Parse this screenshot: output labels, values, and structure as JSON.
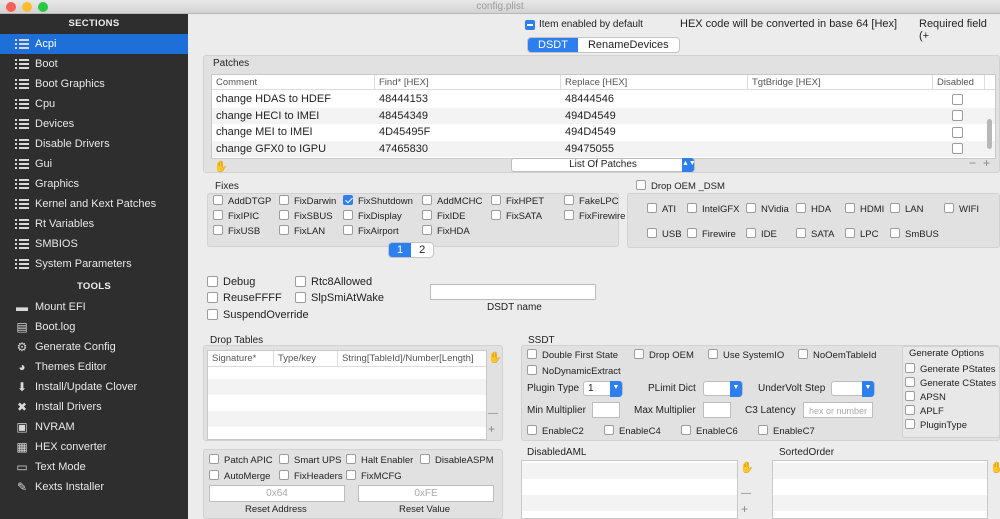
{
  "window": {
    "title": "config.plist"
  },
  "sidebar": {
    "sections_header": "SECTIONS",
    "tools_header": "TOOLS",
    "sections": [
      {
        "label": "Acpi",
        "active": true
      },
      {
        "label": "Boot"
      },
      {
        "label": "Boot Graphics"
      },
      {
        "label": "Cpu"
      },
      {
        "label": "Devices"
      },
      {
        "label": "Disable Drivers"
      },
      {
        "label": "Gui"
      },
      {
        "label": "Graphics"
      },
      {
        "label": "Kernel and Kext Patches"
      },
      {
        "label": "Rt Variables"
      },
      {
        "label": "SMBIOS"
      },
      {
        "label": "System Parameters"
      }
    ],
    "tools": [
      {
        "label": "Mount EFI",
        "icon": "drive-icon"
      },
      {
        "label": "Boot.log",
        "icon": "document-icon"
      },
      {
        "label": "Generate Config",
        "icon": "gear-icon"
      },
      {
        "label": "Themes Editor",
        "icon": "palette-icon"
      },
      {
        "label": "Install/Update Clover",
        "icon": "download-icon"
      },
      {
        "label": "Install Drivers",
        "icon": "wrench-icon"
      },
      {
        "label": "NVRAM",
        "icon": "chip-icon"
      },
      {
        "label": "HEX converter",
        "icon": "calculator-icon"
      },
      {
        "label": "Text Mode",
        "icon": "text-icon"
      },
      {
        "label": "Kexts Installer",
        "icon": "kext-icon"
      }
    ]
  },
  "topbar": {
    "item_enabled": "Item enabled by default",
    "hex_note": "HEX code will be converted in base 64 [Hex]",
    "required": "Required field (+"
  },
  "tabs": {
    "dsdt": "DSDT",
    "rename": "RenameDevices"
  },
  "patches": {
    "title": "Patches",
    "headers": [
      "Comment",
      "Find* [HEX]",
      "Replace [HEX]",
      "TgtBridge [HEX]",
      "Disabled"
    ],
    "rows": [
      {
        "comment": "change HDAS to HDEF",
        "find": "48444153",
        "replace": "48444546"
      },
      {
        "comment": "change HECI to IMEI",
        "find": "48454349",
        "replace": "494D4549"
      },
      {
        "comment": "change MEI to IMEI",
        "find": "4D45495F",
        "replace": "494D4549"
      },
      {
        "comment": "change GFX0 to IGPU",
        "find": "47465830",
        "replace": "49475055"
      }
    ],
    "list_popup": "List Of Patches",
    "minus": "−",
    "plus": "+"
  },
  "fixes": {
    "title": "Fixes",
    "items": [
      {
        "label": "AddDTGP",
        "checked": false
      },
      {
        "label": "FixDarwin",
        "checked": false
      },
      {
        "label": "FixShutdown",
        "checked": true
      },
      {
        "label": "AddMCHC",
        "checked": false
      },
      {
        "label": "FixHPET",
        "checked": false
      },
      {
        "label": "FakeLPC",
        "checked": false
      },
      {
        "label": "FixIPIC",
        "checked": false
      },
      {
        "label": "FixSBUS",
        "checked": false
      },
      {
        "label": "FixDisplay",
        "checked": false
      },
      {
        "label": "FixIDE",
        "checked": false
      },
      {
        "label": "FixSATA",
        "checked": false
      },
      {
        "label": "FixFirewire",
        "checked": false
      },
      {
        "label": "FixUSB",
        "checked": false
      },
      {
        "label": "FixLAN",
        "checked": false
      },
      {
        "label": "FixAirport",
        "checked": false
      },
      {
        "label": "FixHDA",
        "checked": false
      }
    ],
    "pages": [
      "1",
      "2"
    ]
  },
  "drop_oem": {
    "label": "Drop OEM _DSM",
    "items": [
      "ATI",
      "IntelGFX",
      "NVidia",
      "HDA",
      "HDMI",
      "LAN",
      "WIFI",
      "USB",
      "Firewire",
      "IDE",
      "SATA",
      "LPC",
      "SmBUS"
    ]
  },
  "misc": {
    "debug": "Debug",
    "rtc": "Rtc8Allowed",
    "reuse": "ReuseFFFF",
    "slpsmi": "SlpSmiAtWake",
    "suspend": "SuspendOverride",
    "dsdt_name": "DSDT name"
  },
  "drop_tables": {
    "title": "Drop Tables",
    "headers": [
      "Signature*",
      "Type/key",
      "String[TableId]/Number[Length]"
    ]
  },
  "ssdt": {
    "title": "SSDT",
    "double_first": "Double First State",
    "drop_oem": "Drop OEM",
    "use_systemio": "Use SystemIO",
    "no_oem": "NoOemTableId",
    "no_dynamic": "NoDynamicExtract",
    "plugin_type": "Plugin Type",
    "plugin_value": "1",
    "plimit": "PLimit Dict",
    "undervolt": "UnderVolt Step",
    "min_mult": "Min Multiplier",
    "max_mult": "Max Multiplier",
    "c3": "C3 Latency",
    "c3_placeholder": "hex or number",
    "enable_c2": "EnableC2",
    "enable_c4": "EnableC4",
    "enable_c6": "EnableC6",
    "enable_c7": "EnableC7",
    "gen_options": "Generate Options",
    "gen_items": [
      "Generate PStates",
      "Generate CStates",
      "APSN",
      "APLF",
      "PluginType"
    ]
  },
  "bottom_left": {
    "patch_apic": "Patch APIC",
    "smart_ups": "Smart UPS",
    "halt": "Halt Enabler",
    "disable_aspm": "DisableASPM",
    "automerge": "AutoMerge",
    "fixheaders": "FixHeaders",
    "fixmcfg": "FixMCFG",
    "reset_address_val": "0x64",
    "reset_value_val": "0xFE",
    "reset_address": "Reset Address",
    "reset_value": "Reset Value"
  },
  "disabled_aml": {
    "title": "DisabledAML"
  },
  "sorted_order": {
    "title": "SortedOrder"
  },
  "colors": {
    "accent": "#2d7ff0",
    "sidebar_bg": "#2e2e2e",
    "selected": "#1f6fd9"
  }
}
